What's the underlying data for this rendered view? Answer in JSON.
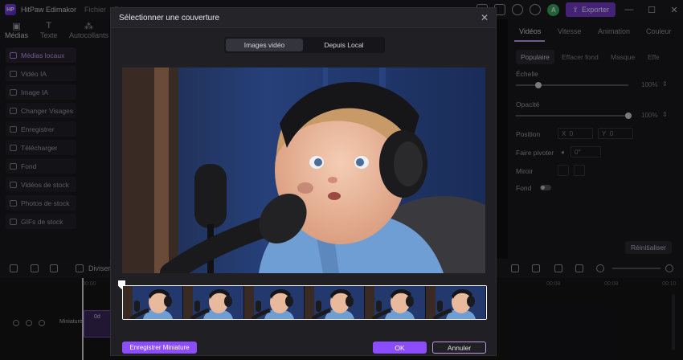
{
  "app": {
    "title": "HitPaw Edimakor",
    "menus": [
      "Fichier",
      "Ré"
    ],
    "export_label": "Exporter",
    "avatar_letter": "A",
    "accent": "#8b4dff"
  },
  "left_tabs": [
    {
      "label": "Médias",
      "icon": "media-icon"
    },
    {
      "label": "Texte",
      "icon": "text-icon"
    },
    {
      "label": "Autocollants",
      "icon": "sticker-icon"
    }
  ],
  "sidebar": {
    "items": [
      {
        "label": "Médias locaux",
        "icon": "folder-icon",
        "active": true
      },
      {
        "label": "Vidéo IA",
        "icon": "ai-video-icon"
      },
      {
        "label": "Image IA",
        "icon": "ai-image-icon"
      },
      {
        "label": "Changer Visages",
        "icon": "face-swap-icon"
      },
      {
        "label": "Enregistrer",
        "icon": "record-icon"
      },
      {
        "label": "Télécharger",
        "icon": "download-icon"
      },
      {
        "label": "Fond",
        "icon": "background-icon"
      },
      {
        "label": "Vidéos de stock",
        "icon": "stock-video-icon"
      },
      {
        "label": "Photos de stock",
        "icon": "stock-photo-icon"
      },
      {
        "label": "GIFs de stock",
        "icon": "stock-gif-icon"
      }
    ]
  },
  "right_panel": {
    "tabs": [
      "Vidéos",
      "Vitesse",
      "Animation",
      "Couleur"
    ],
    "subtabs": [
      "Populaire",
      "Effacer fond",
      "Masque",
      "Effets"
    ],
    "scale_label": "Échelle",
    "scale_value": "100%",
    "scale_level": 0.2,
    "opacity_label": "Opacité",
    "opacity_value": "100%",
    "opacity_level": 1.0,
    "position_label": "Position",
    "pos_x_label": "X",
    "pos_x_value": "0",
    "pos_y_label": "Y",
    "pos_y_value": "0",
    "rotate_label": "Faire pivoter",
    "rotate_value": "0°",
    "mirror_label": "Miroir",
    "fond_label": "Fond",
    "reset_label": "Réinitialiser"
  },
  "timeline": {
    "split_label": "Diviser",
    "cover_label": "Miniature",
    "clip_label": "0d",
    "ticks": [
      "00:00",
      "00:08",
      "00:08",
      "00:10"
    ]
  },
  "modal": {
    "title": "Sélectionner une couverture",
    "tabs": [
      "Images vidéo",
      "Depuis Local"
    ],
    "save_thumbnail_label": "Enregistrer Miniature",
    "ok_label": "OK",
    "cancel_label": "Annuler",
    "thumbnail_count": 6
  }
}
